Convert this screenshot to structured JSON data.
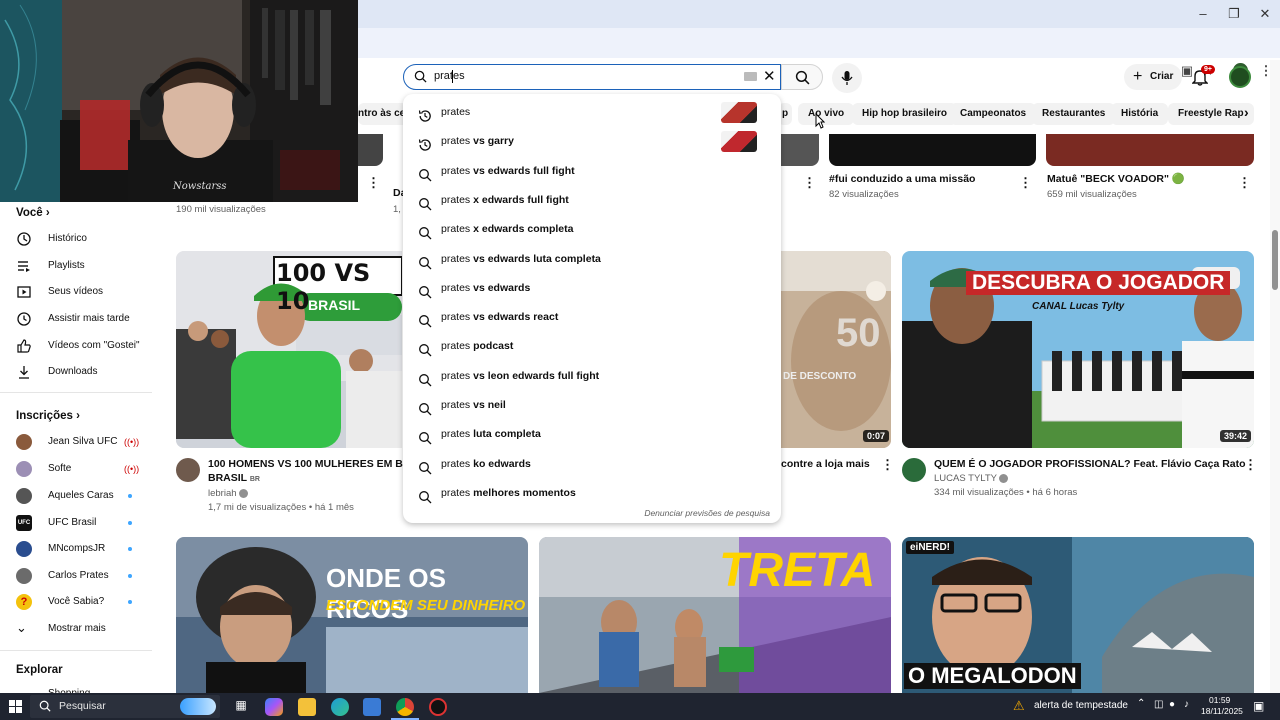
{
  "search": {
    "query": "prates",
    "report_link": "Denunciar previsões de pesquisa"
  },
  "suggestions": [
    {
      "base": "prates",
      "rest": "",
      "icon": "history-icon",
      "has_thumb": true,
      "thumb_color": "#b7342c"
    },
    {
      "base": "prates",
      "rest": " vs garry",
      "icon": "history-icon",
      "has_thumb": true,
      "thumb_color": "#c0282e"
    },
    {
      "base": "prates",
      "rest": " vs edwards full fight",
      "icon": "search-icon"
    },
    {
      "base": "prates",
      "rest": " x edwards full fight",
      "icon": "search-icon"
    },
    {
      "base": "prates",
      "rest": " x edwards completa",
      "icon": "search-icon"
    },
    {
      "base": "prates",
      "rest": " vs edwards luta completa",
      "icon": "search-icon"
    },
    {
      "base": "prates",
      "rest": " vs edwards",
      "icon": "search-icon"
    },
    {
      "base": "prates",
      "rest": " vs edwards react",
      "icon": "search-icon"
    },
    {
      "base": "prates",
      "rest": " podcast",
      "icon": "search-icon"
    },
    {
      "base": "prates",
      "rest": " vs leon edwards full fight",
      "icon": "search-icon"
    },
    {
      "base": "prates",
      "rest": " vs neil",
      "icon": "search-icon"
    },
    {
      "base": "prates",
      "rest": " luta completa",
      "icon": "search-icon"
    },
    {
      "base": "prates",
      "rest": " ko edwards",
      "icon": "search-icon"
    },
    {
      "base": "prates",
      "rest": " melhores momentos",
      "icon": "search-icon"
    }
  ],
  "header": {
    "create_label": "Criar",
    "notif_badge": "9+"
  },
  "chips": [
    {
      "label": "ntro às ce",
      "partial": true
    },
    {
      "label": "p",
      "partial": true
    },
    {
      "label": "Ao vivo"
    },
    {
      "label": "Hip hop brasileiro"
    },
    {
      "label": "Campeonatos"
    },
    {
      "label": "Restaurantes"
    },
    {
      "label": "História"
    },
    {
      "label": "Freestyle Rap"
    }
  ],
  "sidebar": {
    "you_heading": "Você",
    "you_items": [
      {
        "label": "Histórico",
        "icon": "history-icon"
      },
      {
        "label": "Playlists",
        "icon": "playlist-icon"
      },
      {
        "label": "Seus vídeos",
        "icon": "video-icon"
      },
      {
        "label": "Assistir mais tarde",
        "icon": "clock-icon"
      },
      {
        "label": "Vídeos com \"Gostei\"",
        "icon": "like-icon"
      },
      {
        "label": "Downloads",
        "icon": "download-icon"
      }
    ],
    "subs_heading": "Inscrições",
    "subs": [
      {
        "label": "Jean Silva UFC",
        "status": "live",
        "color": "#8a5a3c"
      },
      {
        "label": "Softe",
        "status": "live",
        "color": "#9c8fb5"
      },
      {
        "label": "Aqueles Caras",
        "status": "dot",
        "color": "#555555"
      },
      {
        "label": "UFC Brasil",
        "status": "dot",
        "color": "#111111"
      },
      {
        "label": "MNcompsJR",
        "status": "dot",
        "color": "#2a4d8f"
      },
      {
        "label": "Carlos Prates",
        "status": "dot",
        "color": "#6b6b6b"
      },
      {
        "label": "Você Sabia?",
        "status": "dot",
        "color": "#f4c20d"
      }
    ],
    "show_more": "Mostrar mais",
    "explore_heading": "Explorar",
    "shopping": "Shopping"
  },
  "top_row": {
    "left_views": "190 mil visualizações",
    "left_partial_title": "Da",
    "left_partial_meta": "1,",
    "mid_title": "#fui conduzido a uma missão",
    "mid_views": "82 visualizações",
    "right_title": "Matuê \"BECK VOADOR\" 🟢",
    "right_views": "659 mil visualizações"
  },
  "videos": [
    {
      "title": "100 HOMENS VS 100 MULHERES EM BU",
      "title2": "BRASIL",
      "title2_badge": "BR",
      "channel": "lebriah",
      "meta": "1,7 mi de visualizações • há 1 mês",
      "thumb_text": "100 VS 10",
      "thumb_sub": "BRASIL"
    },
    {
      "title": "contre a loja mais",
      "duration": "0:07",
      "thumb_text": "50",
      "thumb_sub": "DE DESCONTO"
    },
    {
      "title": "QUEM É O JOGADOR PROFISSIONAL? Feat. Flávio Caça Rato",
      "channel": "LUCAS TYLTY",
      "meta": "334 mil visualizações • há 6 horas",
      "duration": "39:42",
      "thumb_text": "DESCUBRA O JOGADOR",
      "thumb_sub": "CANAL Lucas Tylty"
    }
  ],
  "bottom_thumbs": [
    {
      "text1": "ONDE OS RICOS",
      "text2": "ESCONDEM SEU DINHEIRO"
    },
    {
      "text1": "TRETA"
    },
    {
      "text1": "O MEGALODON",
      "badge": "eiNERD!"
    }
  ],
  "taskbar": {
    "search_placeholder": "Pesquisar",
    "weather": "alerta de tempestade",
    "time": "01:59",
    "date": "18/11/2025"
  },
  "webcam": {
    "shirt_text": "Nowstarss"
  }
}
